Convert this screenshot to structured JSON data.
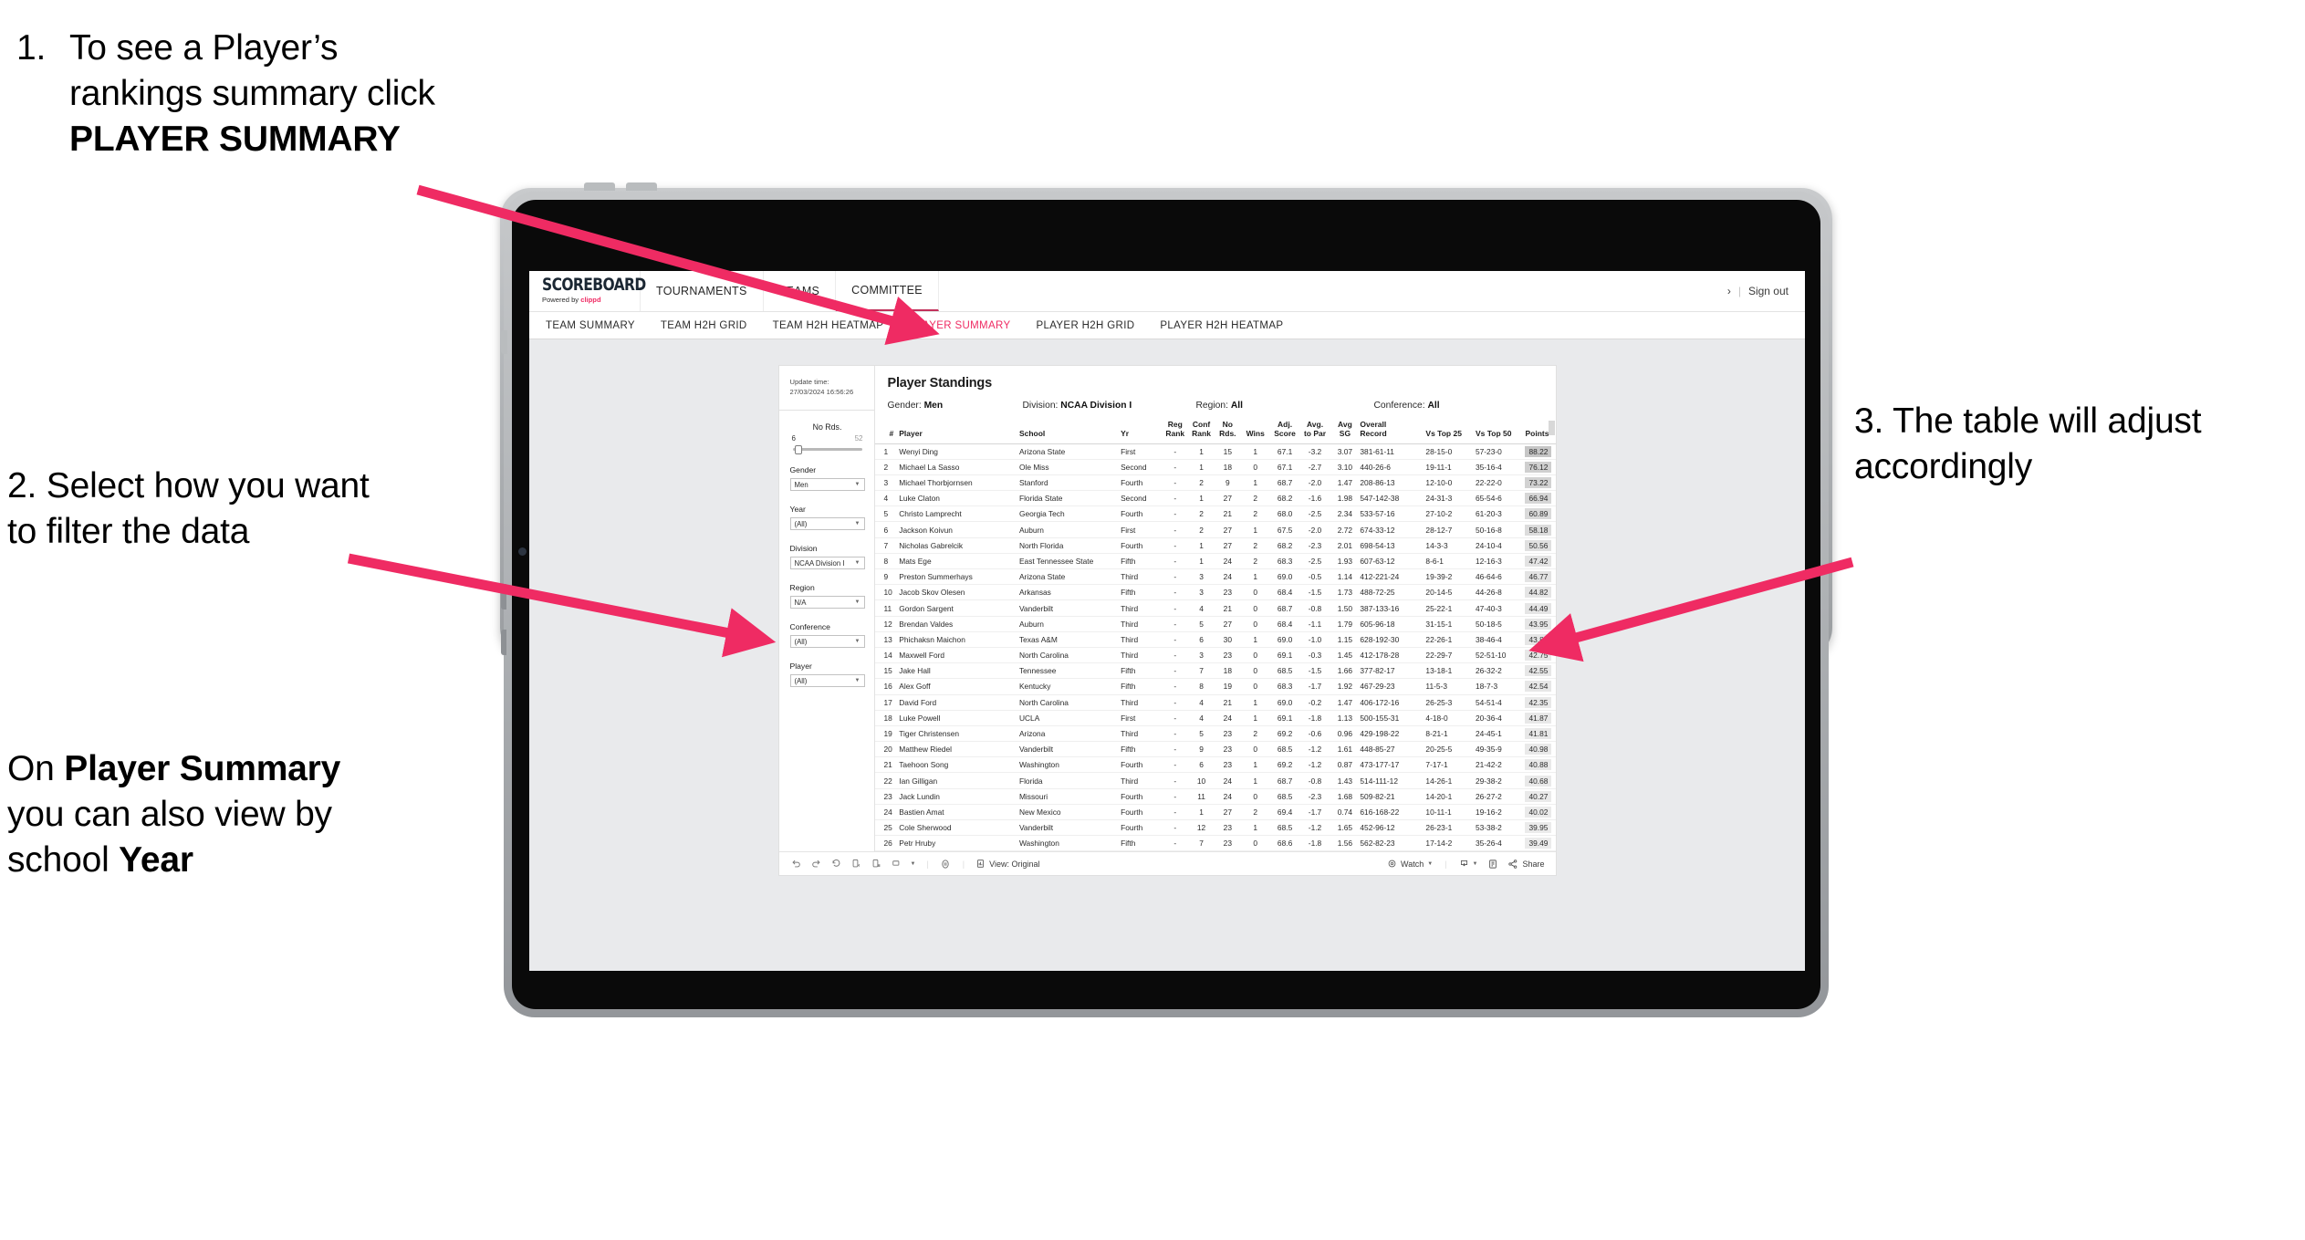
{
  "annotations": {
    "a1_number": "1.",
    "a1_part1": "To see a Player’s rankings summary click ",
    "a1_bold": "PLAYER SUMMARY",
    "a2": "2. Select how you want to filter the data",
    "a2b_part1": "On ",
    "a2b_bold1": "Player Summary",
    "a2b_part2": " you can also view by school ",
    "a2b_bold2": "Year",
    "a3": "3. The table will adjust accordingly",
    "arrow_color": "#ef2b63"
  },
  "app": {
    "logo_main": "SCOREBOARD",
    "logo_sub_prefix": "Powered by ",
    "logo_sub_brand": "clippd",
    "top_nav": [
      {
        "label": "TOURNAMENTS",
        "active": false
      },
      {
        "label": "TEAMS",
        "active": false
      },
      {
        "label": "COMMITTEE",
        "active": true
      }
    ],
    "header_right": {
      "chevron": "›",
      "divider": "|",
      "sign_out": "Sign out"
    },
    "sub_nav": [
      {
        "label": "TEAM SUMMARY",
        "active": false
      },
      {
        "label": "TEAM H2H GRID",
        "active": false
      },
      {
        "label": "TEAM H2H HEATMAP",
        "active": false
      },
      {
        "label": "PLAYER SUMMARY",
        "active": true
      },
      {
        "label": "PLAYER H2H GRID",
        "active": false
      },
      {
        "label": "PLAYER H2H HEATMAP",
        "active": false
      }
    ]
  },
  "sidebar": {
    "update_label": "Update time:",
    "update_value": "27/03/2024 16:56:26",
    "slider": {
      "title": "No Rds.",
      "min": "6",
      "max": "52"
    },
    "filters": [
      {
        "title": "Gender",
        "value": "Men"
      },
      {
        "title": "Year",
        "value": "(All)"
      },
      {
        "title": "Division",
        "value": "NCAA Division I"
      },
      {
        "title": "Region",
        "value": "N/A"
      },
      {
        "title": "Conference",
        "value": "(All)"
      },
      {
        "title": "Player",
        "value": "(All)"
      }
    ]
  },
  "viz": {
    "title": "Player Standings",
    "summary": [
      {
        "label": "Gender:",
        "value": "Men"
      },
      {
        "label": "Division:",
        "value": "NCAA Division I"
      },
      {
        "label": "Region:",
        "value": "All"
      },
      {
        "label": "Conference:",
        "value": "All"
      }
    ],
    "columns": [
      {
        "l1": "#",
        "l2": ""
      },
      {
        "l1": "Player",
        "l2": ""
      },
      {
        "l1": "School",
        "l2": ""
      },
      {
        "l1": "Yr",
        "l2": ""
      },
      {
        "l1": "Reg",
        "l2": "Rank"
      },
      {
        "l1": "Conf",
        "l2": "Rank"
      },
      {
        "l1": "No",
        "l2": "Rds."
      },
      {
        "l1": "Wins",
        "l2": ""
      },
      {
        "l1": "Adj.",
        "l2": "Score"
      },
      {
        "l1": "Avg.",
        "l2": "to Par"
      },
      {
        "l1": "Avg",
        "l2": "SG"
      },
      {
        "l1": "Overall",
        "l2": "Record"
      },
      {
        "l1": "Vs Top 25",
        "l2": ""
      },
      {
        "l1": "Vs Top 50",
        "l2": ""
      },
      {
        "l1": "Points",
        "l2": ""
      }
    ],
    "rows": [
      {
        "rank": "1",
        "player": "Wenyi Ding",
        "school": "Arizona State",
        "yr": "First",
        "reg": "-",
        "conf": "1",
        "rds": "15",
        "wins": "1",
        "adj": "67.1",
        "par": "-3.2",
        "sg": "3.07",
        "rec": "381-61-11",
        "t25": "28-15-0",
        "t50": "57-23-0",
        "pts": "88.22",
        "shade": "#c6c6c6"
      },
      {
        "rank": "2",
        "player": "Michael La Sasso",
        "school": "Ole Miss",
        "yr": "Second",
        "reg": "-",
        "conf": "1",
        "rds": "18",
        "wins": "0",
        "adj": "67.1",
        "par": "-2.7",
        "sg": "3.10",
        "rec": "440-26-6",
        "t25": "19-11-1",
        "t50": "35-16-4",
        "pts": "76.12",
        "shade": "#cfcfcf"
      },
      {
        "rank": "3",
        "player": "Michael Thorbjornsen",
        "school": "Stanford",
        "yr": "Fourth",
        "reg": "-",
        "conf": "2",
        "rds": "9",
        "wins": "1",
        "adj": "68.7",
        "par": "-2.0",
        "sg": "1.47",
        "rec": "208-86-13",
        "t25": "12-10-0",
        "t50": "22-22-0",
        "pts": "73.22",
        "shade": "#d2d2d2"
      },
      {
        "rank": "4",
        "player": "Luke Claton",
        "school": "Florida State",
        "yr": "Second",
        "reg": "-",
        "conf": "1",
        "rds": "27",
        "wins": "2",
        "adj": "68.2",
        "par": "-1.6",
        "sg": "1.98",
        "rec": "547-142-38",
        "t25": "24-31-3",
        "t50": "65-54-6",
        "pts": "66.94",
        "shade": "#d6d6d6"
      },
      {
        "rank": "5",
        "player": "Christo Lamprecht",
        "school": "Georgia Tech",
        "yr": "Fourth",
        "reg": "-",
        "conf": "2",
        "rds": "21",
        "wins": "2",
        "adj": "68.0",
        "par": "-2.5",
        "sg": "2.34",
        "rec": "533-57-16",
        "t25": "27-10-2",
        "t50": "61-20-3",
        "pts": "60.89",
        "shade": "#dadada"
      },
      {
        "rank": "6",
        "player": "Jackson Koivun",
        "school": "Auburn",
        "yr": "First",
        "reg": "-",
        "conf": "2",
        "rds": "27",
        "wins": "1",
        "adj": "67.5",
        "par": "-2.0",
        "sg": "2.72",
        "rec": "674-33-12",
        "t25": "28-12-7",
        "t50": "50-16-8",
        "pts": "58.18",
        "shade": "#dcdcdc"
      },
      {
        "rank": "7",
        "player": "Nicholas Gabrelcik",
        "school": "North Florida",
        "yr": "Fourth",
        "reg": "-",
        "conf": "1",
        "rds": "27",
        "wins": "2",
        "adj": "68.2",
        "par": "-2.3",
        "sg": "2.01",
        "rec": "698-54-13",
        "t25": "14-3-3",
        "t50": "24-10-4",
        "pts": "50.56",
        "shade": "#e0e0e0"
      },
      {
        "rank": "8",
        "player": "Mats Ege",
        "school": "East Tennessee State",
        "yr": "Fifth",
        "reg": "-",
        "conf": "1",
        "rds": "24",
        "wins": "2",
        "adj": "68.3",
        "par": "-2.5",
        "sg": "1.93",
        "rec": "607-63-12",
        "t25": "8-6-1",
        "t50": "12-16-3",
        "pts": "47.42",
        "shade": "#e3e3e3"
      },
      {
        "rank": "9",
        "player": "Preston Summerhays",
        "school": "Arizona State",
        "yr": "Third",
        "reg": "-",
        "conf": "3",
        "rds": "24",
        "wins": "1",
        "adj": "69.0",
        "par": "-0.5",
        "sg": "1.14",
        "rec": "412-221-24",
        "t25": "19-39-2",
        "t50": "46-64-6",
        "pts": "46.77",
        "shade": "#e3e3e3"
      },
      {
        "rank": "10",
        "player": "Jacob Skov Olesen",
        "school": "Arkansas",
        "yr": "Fifth",
        "reg": "-",
        "conf": "3",
        "rds": "23",
        "wins": "0",
        "adj": "68.4",
        "par": "-1.5",
        "sg": "1.73",
        "rec": "488-72-25",
        "t25": "20-14-5",
        "t50": "44-26-8",
        "pts": "44.82",
        "shade": "#e5e5e5"
      },
      {
        "rank": "11",
        "player": "Gordon Sargent",
        "school": "Vanderbilt",
        "yr": "Third",
        "reg": "-",
        "conf": "4",
        "rds": "21",
        "wins": "0",
        "adj": "68.7",
        "par": "-0.8",
        "sg": "1.50",
        "rec": "387-133-16",
        "t25": "25-22-1",
        "t50": "47-40-3",
        "pts": "44.49",
        "shade": "#e5e5e5"
      },
      {
        "rank": "12",
        "player": "Brendan Valdes",
        "school": "Auburn",
        "yr": "Third",
        "reg": "-",
        "conf": "5",
        "rds": "27",
        "wins": "0",
        "adj": "68.4",
        "par": "-1.1",
        "sg": "1.79",
        "rec": "605-96-18",
        "t25": "31-15-1",
        "t50": "50-18-5",
        "pts": "43.95",
        "shade": "#e6e6e6"
      },
      {
        "rank": "13",
        "player": "Phichaksn Maichon",
        "school": "Texas A&M",
        "yr": "Third",
        "reg": "-",
        "conf": "6",
        "rds": "30",
        "wins": "1",
        "adj": "69.0",
        "par": "-1.0",
        "sg": "1.15",
        "rec": "628-192-30",
        "t25": "22-26-1",
        "t50": "38-46-4",
        "pts": "43.83",
        "shade": "#e6e6e6"
      },
      {
        "rank": "14",
        "player": "Maxwell Ford",
        "school": "North Carolina",
        "yr": "Third",
        "reg": "-",
        "conf": "3",
        "rds": "23",
        "wins": "0",
        "adj": "69.1",
        "par": "-0.3",
        "sg": "1.45",
        "rec": "412-178-28",
        "t25": "22-29-7",
        "t50": "52-51-10",
        "pts": "42.75",
        "shade": "#e7e7e7"
      },
      {
        "rank": "15",
        "player": "Jake Hall",
        "school": "Tennessee",
        "yr": "Fifth",
        "reg": "-",
        "conf": "7",
        "rds": "18",
        "wins": "0",
        "adj": "68.5",
        "par": "-1.5",
        "sg": "1.66",
        "rec": "377-82-17",
        "t25": "13-18-1",
        "t50": "26-32-2",
        "pts": "42.55",
        "shade": "#e7e7e7"
      },
      {
        "rank": "16",
        "player": "Alex Goff",
        "school": "Kentucky",
        "yr": "Fifth",
        "reg": "-",
        "conf": "8",
        "rds": "19",
        "wins": "0",
        "adj": "68.3",
        "par": "-1.7",
        "sg": "1.92",
        "rec": "467-29-23",
        "t25": "11-5-3",
        "t50": "18-7-3",
        "pts": "42.54",
        "shade": "#e7e7e7"
      },
      {
        "rank": "17",
        "player": "David Ford",
        "school": "North Carolina",
        "yr": "Third",
        "reg": "-",
        "conf": "4",
        "rds": "21",
        "wins": "1",
        "adj": "69.0",
        "par": "-0.2",
        "sg": "1.47",
        "rec": "406-172-16",
        "t25": "26-25-3",
        "t50": "54-51-4",
        "pts": "42.35",
        "shade": "#e8e8e8"
      },
      {
        "rank": "18",
        "player": "Luke Powell",
        "school": "UCLA",
        "yr": "First",
        "reg": "-",
        "conf": "4",
        "rds": "24",
        "wins": "1",
        "adj": "69.1",
        "par": "-1.8",
        "sg": "1.13",
        "rec": "500-155-31",
        "t25": "4-18-0",
        "t50": "20-36-4",
        "pts": "41.87",
        "shade": "#e8e8e8"
      },
      {
        "rank": "19",
        "player": "Tiger Christensen",
        "school": "Arizona",
        "yr": "Third",
        "reg": "-",
        "conf": "5",
        "rds": "23",
        "wins": "2",
        "adj": "69.2",
        "par": "-0.6",
        "sg": "0.96",
        "rec": "429-198-22",
        "t25": "8-21-1",
        "t50": "24-45-1",
        "pts": "41.81",
        "shade": "#e8e8e8"
      },
      {
        "rank": "20",
        "player": "Matthew Riedel",
        "school": "Vanderbilt",
        "yr": "Fifth",
        "reg": "-",
        "conf": "9",
        "rds": "23",
        "wins": "0",
        "adj": "68.5",
        "par": "-1.2",
        "sg": "1.61",
        "rec": "448-85-27",
        "t25": "20-25-5",
        "t50": "49-35-9",
        "pts": "40.98",
        "shade": "#e9e9e9"
      },
      {
        "rank": "21",
        "player": "Taehoon Song",
        "school": "Washington",
        "yr": "Fourth",
        "reg": "-",
        "conf": "6",
        "rds": "23",
        "wins": "1",
        "adj": "69.2",
        "par": "-1.2",
        "sg": "0.87",
        "rec": "473-177-17",
        "t25": "7-17-1",
        "t50": "21-42-2",
        "pts": "40.88",
        "shade": "#e9e9e9"
      },
      {
        "rank": "22",
        "player": "Ian Gilligan",
        "school": "Florida",
        "yr": "Third",
        "reg": "-",
        "conf": "10",
        "rds": "24",
        "wins": "1",
        "adj": "68.7",
        "par": "-0.8",
        "sg": "1.43",
        "rec": "514-111-12",
        "t25": "14-26-1",
        "t50": "29-38-2",
        "pts": "40.68",
        "shade": "#e9e9e9"
      },
      {
        "rank": "23",
        "player": "Jack Lundin",
        "school": "Missouri",
        "yr": "Fourth",
        "reg": "-",
        "conf": "11",
        "rds": "24",
        "wins": "0",
        "adj": "68.5",
        "par": "-2.3",
        "sg": "1.68",
        "rec": "509-82-21",
        "t25": "14-20-1",
        "t50": "26-27-2",
        "pts": "40.27",
        "shade": "#eaeaea"
      },
      {
        "rank": "24",
        "player": "Bastien Amat",
        "school": "New Mexico",
        "yr": "Fourth",
        "reg": "-",
        "conf": "1",
        "rds": "27",
        "wins": "2",
        "adj": "69.4",
        "par": "-1.7",
        "sg": "0.74",
        "rec": "616-168-22",
        "t25": "10-11-1",
        "t50": "19-16-2",
        "pts": "40.02",
        "shade": "#eaeaea"
      },
      {
        "rank": "25",
        "player": "Cole Sherwood",
        "school": "Vanderbilt",
        "yr": "Fourth",
        "reg": "-",
        "conf": "12",
        "rds": "23",
        "wins": "1",
        "adj": "68.5",
        "par": "-1.2",
        "sg": "1.65",
        "rec": "452-96-12",
        "t25": "26-23-1",
        "t50": "53-38-2",
        "pts": "39.95",
        "shade": "#ebebeb"
      },
      {
        "rank": "26",
        "player": "Petr Hruby",
        "school": "Washington",
        "yr": "Fifth",
        "reg": "-",
        "conf": "7",
        "rds": "23",
        "wins": "0",
        "adj": "68.6",
        "par": "-1.8",
        "sg": "1.56",
        "rec": "562-82-23",
        "t25": "17-14-2",
        "t50": "35-26-4",
        "pts": "39.49",
        "shade": "#ebebeb"
      }
    ],
    "toolbar": {
      "view_label": "View: Original",
      "watch_label": "Watch",
      "share_label": "Share"
    }
  }
}
